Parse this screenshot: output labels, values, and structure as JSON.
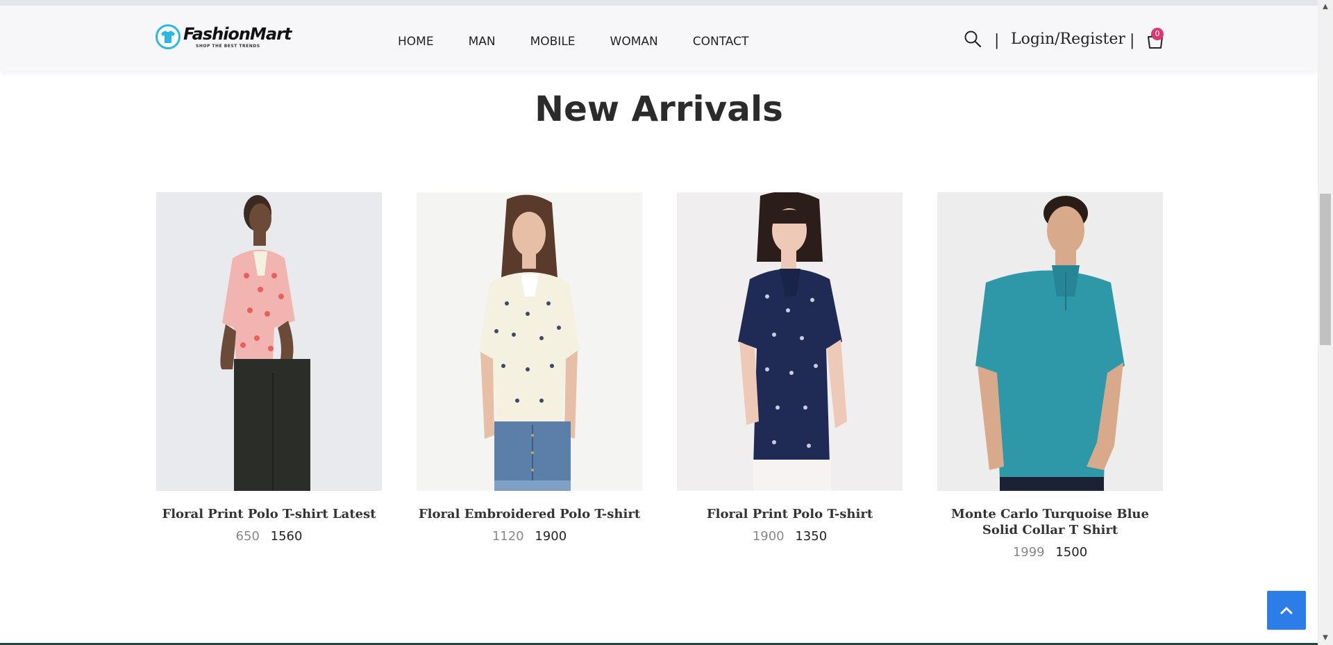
{
  "header": {
    "logo_title": "FashionMart",
    "logo_tagline": "SHOP THE BEST TRENDS",
    "nav": [
      "HOME",
      "MAN",
      "MOBILE",
      "WOMAN",
      "CONTACT"
    ],
    "separator": "|",
    "login_label": "Login/Register",
    "cart_count": "0",
    "colors": {
      "logo_accent": "#2bb7e0",
      "badge": "#d63a6e"
    }
  },
  "section": {
    "title": "New Arrivals"
  },
  "products": [
    {
      "name": "Floral Print Polo T-shirt Latest",
      "old_price": "650",
      "price": "1560",
      "image_icon": "woman-pink-floral-polo-photo"
    },
    {
      "name": "Floral Embroidered Polo T-shirt",
      "old_price": "1120",
      "price": "1900",
      "image_icon": "woman-cream-polo-photo"
    },
    {
      "name": "Floral Print Polo T-shirt",
      "old_price": "1900",
      "price": "1350",
      "image_icon": "woman-navy-polo-photo"
    },
    {
      "name": "Monte Carlo Turquoise Blue Solid Collar T Shirt",
      "old_price": "1999",
      "price": "1500",
      "image_icon": "man-teal-polo-photo"
    }
  ],
  "back_to_top_icon": "chevron-up-icon",
  "colors": {
    "back_to_top": "#2d7de8"
  }
}
